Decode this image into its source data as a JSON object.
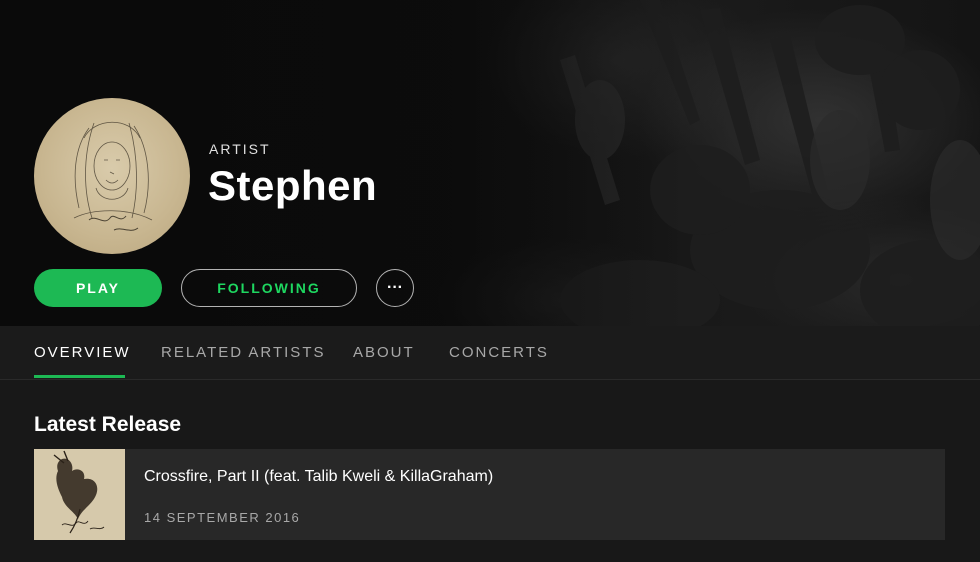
{
  "header": {
    "type_label": "ARTIST",
    "artist_name": "Stephen"
  },
  "actions": {
    "play_label": "PLAY",
    "follow_label": "FOLLOWING",
    "more_label": "···"
  },
  "tabs": [
    {
      "label": "OVERVIEW",
      "active": true
    },
    {
      "label": "RELATED ARTISTS",
      "active": false
    },
    {
      "label": "ABOUT",
      "active": false
    },
    {
      "label": "CONCERTS",
      "active": false
    }
  ],
  "latest_release": {
    "section_title": "Latest Release",
    "title": "Crossfire, Part II (feat. Talib Kweli & KillaGraham)",
    "date": "14 SEPTEMBER 2016"
  },
  "colors": {
    "accent": "#1db954",
    "background": "#181818",
    "card": "#282828"
  }
}
